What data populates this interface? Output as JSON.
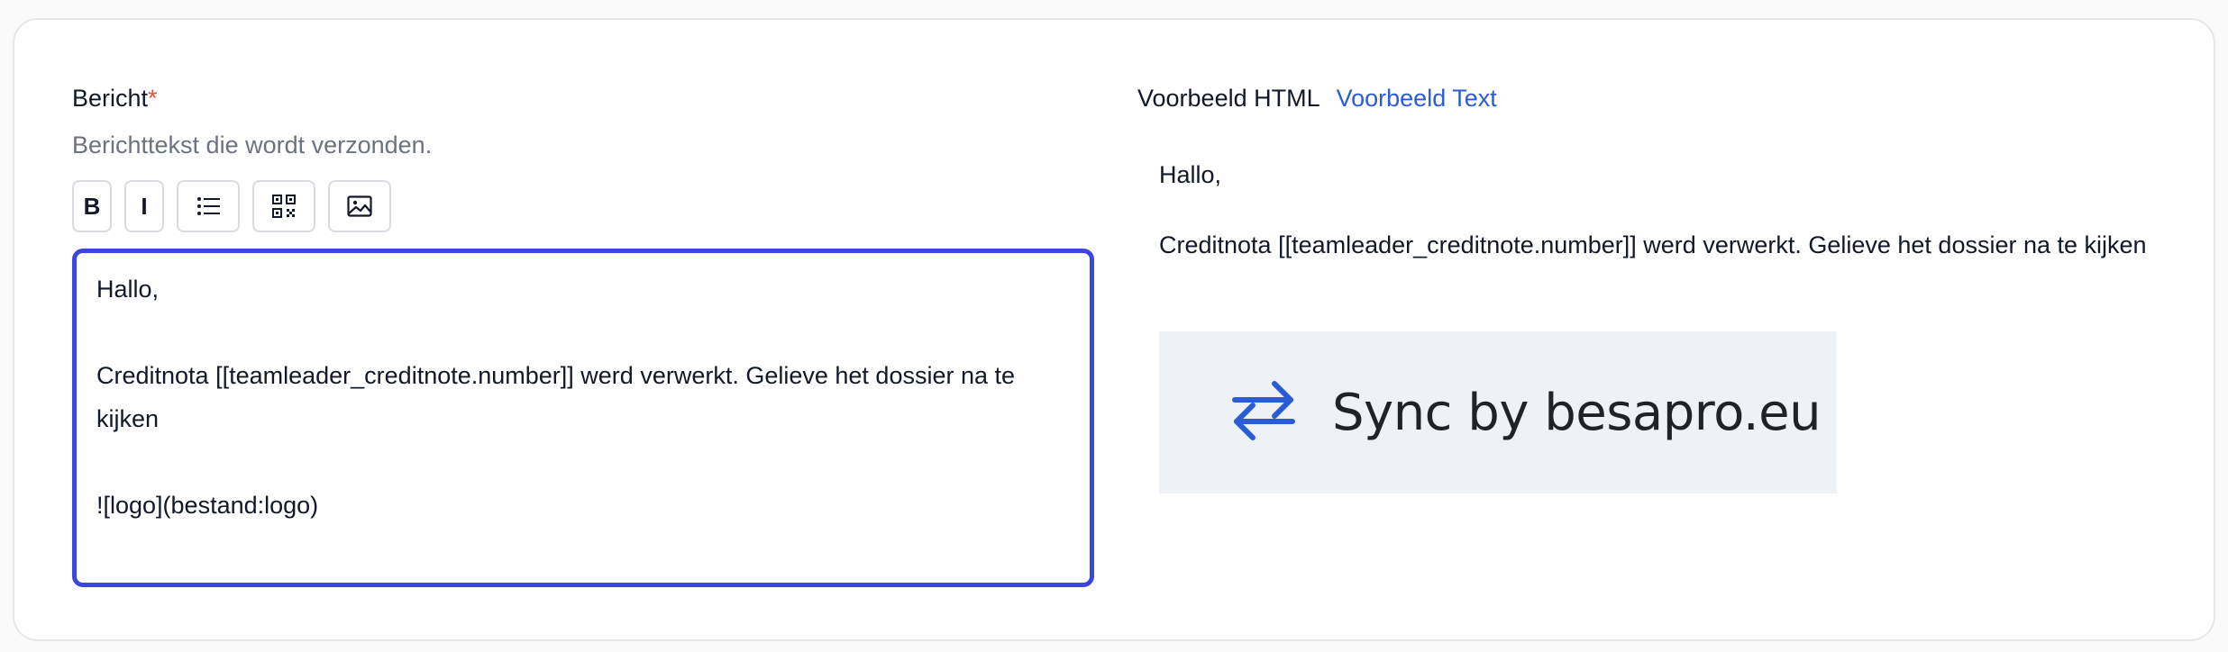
{
  "message_field": {
    "label": "Bericht",
    "required_marker": "*",
    "help_text": "Berichttekst die wordt verzonden."
  },
  "toolbar": {
    "bold_label": "B",
    "italic_label": "I",
    "list_icon": "bulleted-list-icon",
    "qr_icon": "qr-code-icon",
    "image_icon": "image-icon"
  },
  "editor": {
    "line1": "Hallo,",
    "line2": "Creditnota [[teamleader_creditnote.number]] werd verwerkt. Gelieve het dossier na te kijken",
    "line3": "![logo](bestand:logo)",
    "border_color": "#3b45e0"
  },
  "preview_tabs": {
    "html_label": "Voorbeeld HTML",
    "text_label": "Voorbeeld Text"
  },
  "preview": {
    "line1": "Hallo,",
    "line2": "Creditnota [[teamleader_creditnote.number]] werd verwerkt. Gelieve het dossier na te kijken",
    "logo_text": "Sync by besapro.eu",
    "logo_icon": "sync-arrows-icon",
    "logo_icon_color": "#2b5bd7"
  }
}
